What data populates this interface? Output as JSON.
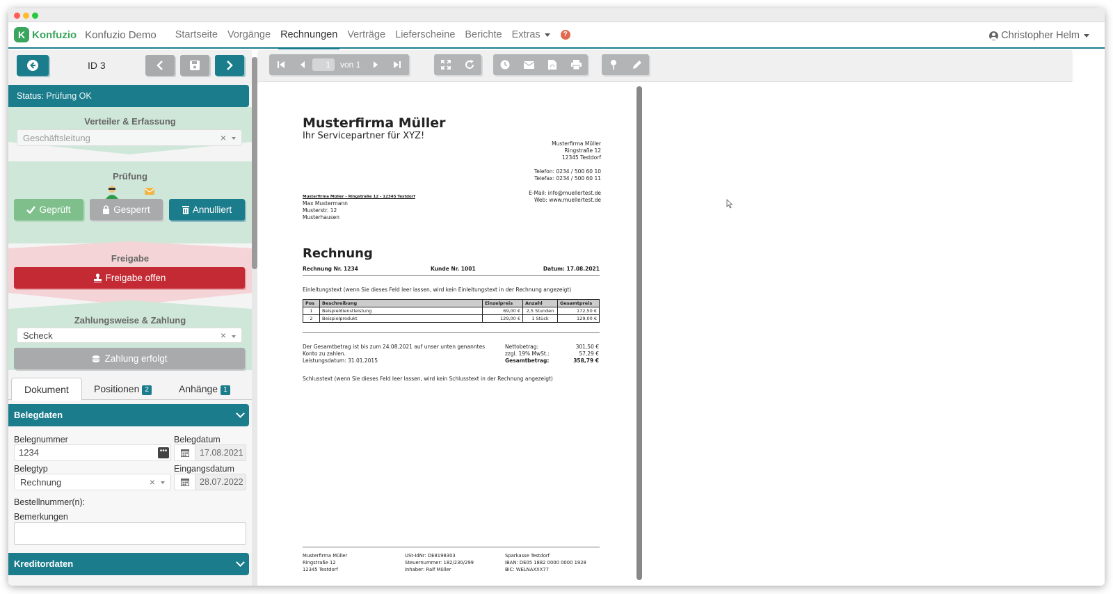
{
  "app": {
    "logo_text": "Konfuzio",
    "name": "Konfuzio Demo",
    "nav": [
      "Startseite",
      "Vorgänge",
      "Rechnungen",
      "Verträge",
      "Lieferscheine",
      "Berichte",
      "Extras"
    ],
    "active_nav": "Rechnungen",
    "user": "Christopher Helm",
    "help_glyph": "?"
  },
  "left": {
    "id_label": "ID 3",
    "status_prefix": "Status:",
    "status_value": "Prüfung OK",
    "verteiler": {
      "title": "Verteiler & Erfassung",
      "value": "Geschäftsleitung"
    },
    "pruefung": {
      "title": "Prüfung",
      "btn_geprueft": "Geprüft",
      "btn_gesperrt": "Gesperrt",
      "btn_annulliert": "Annulliert"
    },
    "freigabe": {
      "title": "Freigabe",
      "btn": "Freigabe offen"
    },
    "zahlung": {
      "title": "Zahlungsweise & Zahlung",
      "value": "Scheck",
      "btn": "Zahlung erfolgt"
    },
    "tabs": [
      {
        "label": "Dokument",
        "badge": ""
      },
      {
        "label": "Positionen",
        "badge": "2"
      },
      {
        "label": "Anhänge",
        "badge": "1"
      }
    ],
    "belegdaten": {
      "header": "Belegdaten",
      "belegnummer_label": "Belegnummer",
      "belegnummer_value": "1234",
      "belegdatum_label": "Belegdatum",
      "belegdatum_value": "17.08.2021",
      "belegtyp_label": "Belegtyp",
      "belegtyp_value": "Rechnung",
      "eingangsdatum_label": "Eingangsdatum",
      "eingangsdatum_value": "28.07.2022",
      "bestellnummer_label": "Bestellnummer(n):",
      "bemerkungen_label": "Bemerkungen",
      "bemerkungen_value": ""
    },
    "kreditordaten": {
      "header": "Kreditordaten"
    }
  },
  "viewer": {
    "page_current": "1",
    "page_of": "von 1"
  },
  "document": {
    "company": "Musterfirma Müller",
    "tagline": "Ihr Servicepartner für XYZ!",
    "sender_block": [
      "Musterfirma Müller",
      "Ringstraße 12",
      "12345 Testdorf"
    ],
    "contact_block": [
      "Telefon: 0234 / 500 60 10",
      "Telefax: 0234 / 500 60 11"
    ],
    "web_block": [
      "E-Mail: info@muellertest.de",
      "Web: www.muellertest.de"
    ],
    "return_line": "Musterfirma Müller - Ringstraße 12 - 12345 Testdorf",
    "recipient": [
      "Max Mustermann",
      "Musterstr. 12",
      "Musterhausen"
    ],
    "heading": "Rechnung",
    "rechnung_nr": "Rechnung Nr. 1234",
    "kunde_nr": "Kunde Nr. 1001",
    "datum": "Datum: 17.08.2021",
    "intro": "Einleitungstext (wenn Sie dieses Feld leer lassen, wird kein Einleitungstext in der Rechnung angezeigt)",
    "table": {
      "headers": [
        "Pos",
        "Beschreibung",
        "Einzelpreis",
        "Anzahl",
        "Gesamtpreis"
      ],
      "rows": [
        [
          "1",
          "Beispieldienstleistung",
          "69,00 €",
          "2,5 Stunden",
          "172,50 €"
        ],
        [
          "2",
          "Beispielprodukt",
          "129,00 €",
          "1 Stück",
          "129,00 €"
        ]
      ]
    },
    "payment_text": [
      "Der Gesamtbetrag ist bis zum 24.08.2021 auf unser unten genanntes",
      "Konto zu zahlen.",
      "Leistungsdatum: 31.01.2015"
    ],
    "totals_labels": [
      "Nettobetrag:",
      "zzgl. 19% MwSt.:",
      "Gesamtbetrag:"
    ],
    "totals_values": [
      "301,50 €",
      "57,29 €",
      "358,79 €"
    ],
    "closing": "Schlusstext (wenn Sie dieses Feld leer lassen, wird kein Schlusstext in der Rechnung angezeigt)",
    "footer_col1": [
      "Musterfirma Müller",
      "Ringstraße 12",
      "12345 Testdorf"
    ],
    "footer_col2": [
      "USt-IdNr: DE8198303",
      "Steuernummer: 182/230/299",
      "Inhaber: Ralf Müller"
    ],
    "footer_col3": [
      "Sparkasse Testdorf",
      "IBAN: DE05 1882 0000 0000 1928",
      "BIC: WELNAXXX77"
    ]
  },
  "colors": {
    "teal": "#1b7c8c",
    "green_section": "#cfe7d8",
    "red_section": "#f4d4d6",
    "red_button": "#c42a34",
    "green_button": "#7fbf8c",
    "grey_button": "#a8aaac"
  }
}
